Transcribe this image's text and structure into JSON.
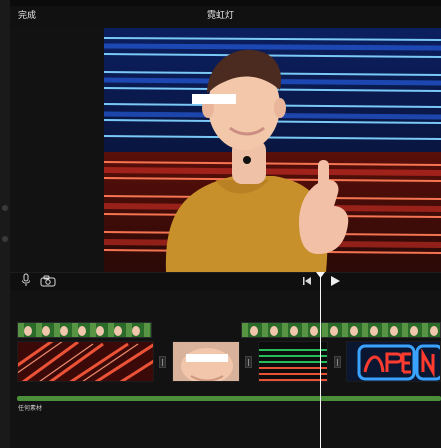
{
  "header": {
    "done_label": "完成",
    "project_title": "霓虹灯"
  },
  "timeline": {
    "audio_track_label": "任何素材"
  },
  "icons": [
    "microphone-icon",
    "camera-icon",
    "skip-to-start-icon",
    "play-icon",
    "split-handle-icon"
  ],
  "colors": {
    "background": "#0b0b0b",
    "audio_track": "#4b8f3a",
    "playhead": "#f6f6f6",
    "neon_blue": "#2d6bff",
    "neon_red": "#ff3b2f",
    "shirt": "#c8902b"
  }
}
